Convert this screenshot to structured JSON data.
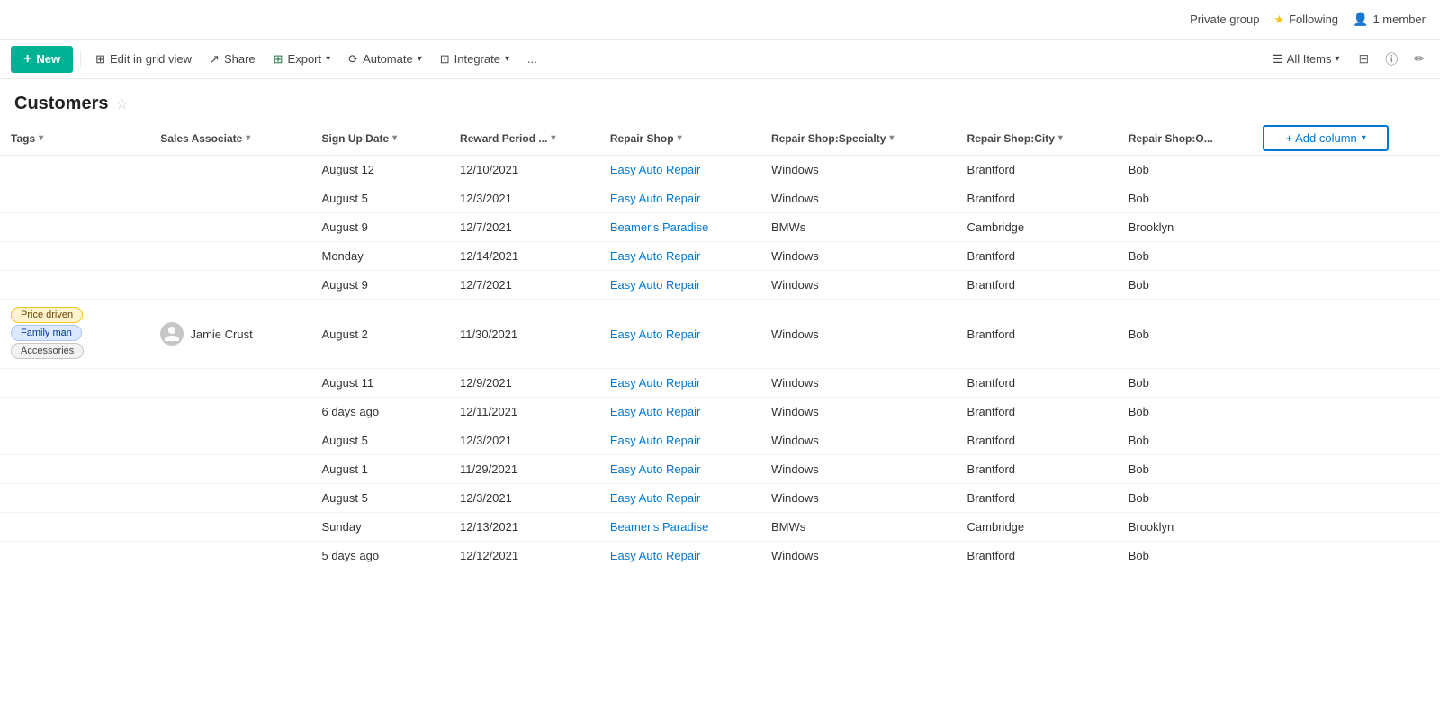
{
  "topbar": {
    "private_group": "Private group",
    "following": "Following",
    "member_count": "1 member"
  },
  "toolbar": {
    "new_label": "New",
    "edit_grid_label": "Edit in grid view",
    "share_label": "Share",
    "export_label": "Export",
    "automate_label": "Automate",
    "integrate_label": "Integrate",
    "more_label": "...",
    "all_items_label": "All Items"
  },
  "page": {
    "title": "Customers"
  },
  "table": {
    "columns": [
      {
        "key": "tags",
        "label": "Tags",
        "has_chevron": true
      },
      {
        "key": "sales_associate",
        "label": "Sales Associate",
        "has_chevron": true
      },
      {
        "key": "sign_up_date",
        "label": "Sign Up Date",
        "has_chevron": true
      },
      {
        "key": "reward_period",
        "label": "Reward Period ...",
        "has_chevron": true
      },
      {
        "key": "repair_shop",
        "label": "Repair Shop",
        "has_chevron": true
      },
      {
        "key": "specialty",
        "label": "Repair Shop:Specialty",
        "has_chevron": true
      },
      {
        "key": "city",
        "label": "Repair Shop:City",
        "has_chevron": true
      },
      {
        "key": "owner",
        "label": "Repair Shop:O...",
        "has_chevron": false
      }
    ],
    "add_column_label": "+ Add column",
    "rows": [
      {
        "tags": [],
        "sales_associate": "",
        "sign_up_date": "August 12",
        "reward_period": "12/10/2021",
        "repair_shop": "Easy Auto Repair",
        "specialty": "Windows",
        "city": "Brantford",
        "owner": "Bob"
      },
      {
        "tags": [],
        "sales_associate": "",
        "sign_up_date": "August 5",
        "reward_period": "12/3/2021",
        "repair_shop": "Easy Auto Repair",
        "specialty": "Windows",
        "city": "Brantford",
        "owner": "Bob"
      },
      {
        "tags": [],
        "sales_associate": "",
        "sign_up_date": "August 9",
        "reward_period": "12/7/2021",
        "repair_shop": "Beamer's Paradise",
        "specialty": "BMWs",
        "city": "Cambridge",
        "owner": "Brooklyn"
      },
      {
        "tags": [],
        "sales_associate": "",
        "sign_up_date": "Monday",
        "reward_period": "12/14/2021",
        "repair_shop": "Easy Auto Repair",
        "specialty": "Windows",
        "city": "Brantford",
        "owner": "Bob"
      },
      {
        "tags": [],
        "sales_associate": "",
        "sign_up_date": "August 9",
        "reward_period": "12/7/2021",
        "repair_shop": "Easy Auto Repair",
        "specialty": "Windows",
        "city": "Brantford",
        "owner": "Bob"
      },
      {
        "tags": [
          "Price driven",
          "Family man",
          "Accessories"
        ],
        "sales_associate": "Jamie Crust",
        "sign_up_date": "August 2",
        "reward_period": "11/30/2021",
        "repair_shop": "Easy Auto Repair",
        "specialty": "Windows",
        "city": "Brantford",
        "owner": "Bob"
      },
      {
        "tags": [],
        "sales_associate": "",
        "sign_up_date": "August 11",
        "reward_period": "12/9/2021",
        "repair_shop": "Easy Auto Repair",
        "specialty": "Windows",
        "city": "Brantford",
        "owner": "Bob"
      },
      {
        "tags": [],
        "sales_associate": "",
        "sign_up_date": "6 days ago",
        "reward_period": "12/11/2021",
        "repair_shop": "Easy Auto Repair",
        "specialty": "Windows",
        "city": "Brantford",
        "owner": "Bob"
      },
      {
        "tags": [],
        "sales_associate": "",
        "sign_up_date": "August 5",
        "reward_period": "12/3/2021",
        "repair_shop": "Easy Auto Repair",
        "specialty": "Windows",
        "city": "Brantford",
        "owner": "Bob"
      },
      {
        "tags": [],
        "sales_associate": "",
        "sign_up_date": "August 1",
        "reward_period": "11/29/2021",
        "repair_shop": "Easy Auto Repair",
        "specialty": "Windows",
        "city": "Brantford",
        "owner": "Bob"
      },
      {
        "tags": [],
        "sales_associate": "",
        "sign_up_date": "August 5",
        "reward_period": "12/3/2021",
        "repair_shop": "Easy Auto Repair",
        "specialty": "Windows",
        "city": "Brantford",
        "owner": "Bob"
      },
      {
        "tags": [],
        "sales_associate": "",
        "sign_up_date": "Sunday",
        "reward_period": "12/13/2021",
        "repair_shop": "Beamer's Paradise",
        "specialty": "BMWs",
        "city": "Cambridge",
        "owner": "Brooklyn"
      },
      {
        "tags": [],
        "sales_associate": "",
        "sign_up_date": "5 days ago",
        "reward_period": "12/12/2021",
        "repair_shop": "Easy Auto Repair",
        "specialty": "Windows",
        "city": "Brantford",
        "owner": "Bob"
      }
    ],
    "tag_styles": {
      "Price driven": "tag-yellow",
      "Family man": "tag-blue",
      "Accessories": "tag-gray"
    },
    "repair_shop_links": [
      "Easy Auto Repair",
      "Beamer's Paradise"
    ]
  }
}
